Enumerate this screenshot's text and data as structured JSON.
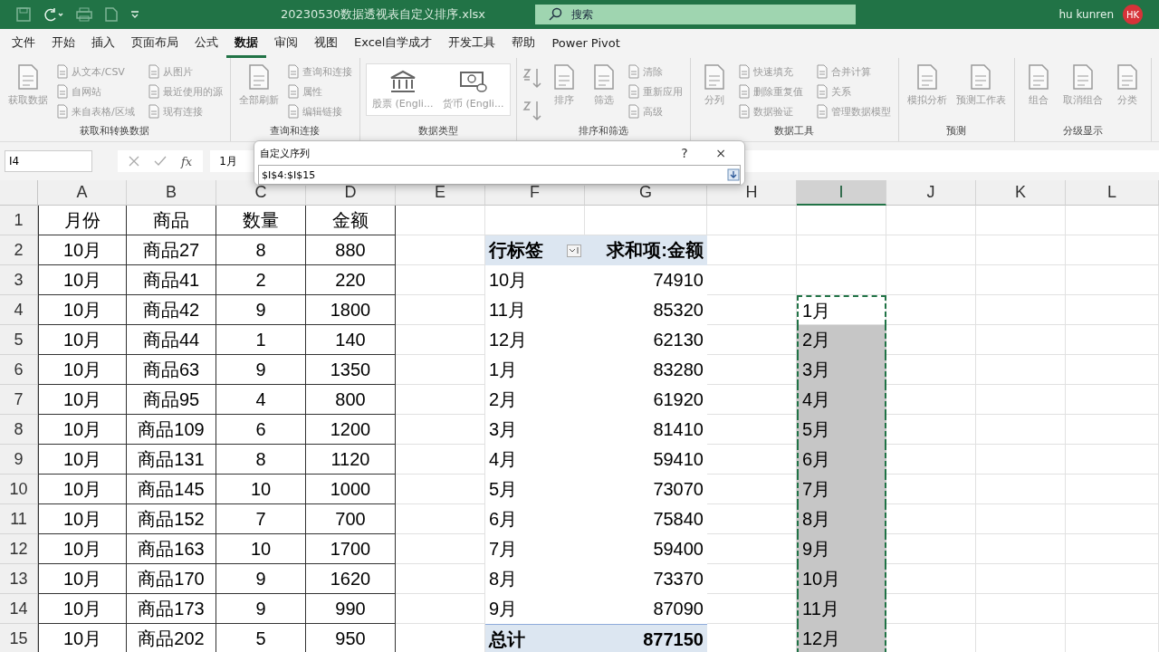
{
  "title_bar": {
    "file_title": "20230530数据透视表自定义排序.xlsx",
    "search_placeholder": "搜索",
    "user_name": "hu kunren",
    "avatar": "HK"
  },
  "menu_tabs": [
    {
      "label": "文件",
      "selected": false
    },
    {
      "label": "开始",
      "selected": false
    },
    {
      "label": "插入",
      "selected": false
    },
    {
      "label": "页面布局",
      "selected": false
    },
    {
      "label": "公式",
      "selected": false
    },
    {
      "label": "数据",
      "selected": true
    },
    {
      "label": "审阅",
      "selected": false
    },
    {
      "label": "视图",
      "selected": false
    },
    {
      "label": "Excel自学成才",
      "selected": false
    },
    {
      "label": "开发工具",
      "selected": false
    },
    {
      "label": "帮助",
      "selected": false
    },
    {
      "label": "Power Pivot",
      "selected": false
    }
  ],
  "ribbon_groups": [
    {
      "label": "获取和转换数据",
      "items": [
        {
          "kind": "large",
          "label": "获取数据"
        },
        {
          "kind": "small",
          "label": "从文本/CSV"
        },
        {
          "kind": "small",
          "label": "自网站"
        },
        {
          "kind": "small",
          "label": "来自表格/区域"
        },
        {
          "kind": "small",
          "label": "从图片"
        },
        {
          "kind": "small",
          "label": "最近使用的源"
        },
        {
          "kind": "small",
          "label": "现有连接"
        }
      ]
    },
    {
      "label": "查询和连接",
      "items": [
        {
          "kind": "large",
          "label": "全部刷新"
        },
        {
          "kind": "small",
          "label": "查询和连接"
        },
        {
          "kind": "small",
          "label": "属性"
        },
        {
          "kind": "small",
          "label": "编辑链接"
        }
      ]
    },
    {
      "label": "数据类型",
      "items": [
        {
          "kind": "gallery",
          "label": "股票 (Engli..."
        },
        {
          "kind": "gallery",
          "label": "货币 (Engli..."
        }
      ]
    },
    {
      "label": "排序和筛选",
      "items": [
        {
          "kind": "icon"
        },
        {
          "kind": "icon"
        },
        {
          "kind": "large",
          "label": "排序"
        },
        {
          "kind": "large",
          "label": "筛选"
        },
        {
          "kind": "small",
          "label": "清除"
        },
        {
          "kind": "small",
          "label": "重新应用"
        },
        {
          "kind": "small",
          "label": "高级"
        }
      ]
    },
    {
      "label": "数据工具",
      "items": [
        {
          "kind": "large",
          "label": "分列"
        },
        {
          "kind": "small",
          "label": "快速填充"
        },
        {
          "kind": "small",
          "label": "删除重复值"
        },
        {
          "kind": "small",
          "label": "数据验证"
        },
        {
          "kind": "small",
          "label": "合并计算"
        },
        {
          "kind": "small",
          "label": "关系"
        },
        {
          "kind": "small",
          "label": "管理数据模型"
        }
      ]
    },
    {
      "label": "预测",
      "items": [
        {
          "kind": "large",
          "label": "模拟分析"
        },
        {
          "kind": "large",
          "label": "预测工作表"
        }
      ]
    },
    {
      "label": "分级显示",
      "items": [
        {
          "kind": "large",
          "label": "组合"
        },
        {
          "kind": "large",
          "label": "取消组合"
        },
        {
          "kind": "large",
          "label": "分类"
        }
      ]
    }
  ],
  "formula_bar": {
    "name_box": "I4",
    "fx": "fx",
    "value": "1月"
  },
  "dialog": {
    "title": "自定义序列",
    "help": "?",
    "close": "×",
    "reference": "$I$4:$I$15"
  },
  "columns": [
    {
      "label": "A",
      "selected": false
    },
    {
      "label": "B",
      "selected": false
    },
    {
      "label": "C",
      "selected": false
    },
    {
      "label": "D",
      "selected": false
    },
    {
      "label": "E",
      "selected": false
    },
    {
      "label": "F",
      "selected": false
    },
    {
      "label": "G",
      "selected": false
    },
    {
      "label": "H",
      "selected": false
    },
    {
      "label": "I",
      "selected": true
    },
    {
      "label": "J",
      "selected": false
    },
    {
      "label": "K",
      "selected": false
    },
    {
      "label": "L",
      "selected": false
    }
  ],
  "rows": [
    {
      "header": "1",
      "table": [
        "月份",
        "商品",
        "数量",
        "金额"
      ]
    },
    {
      "header": "2",
      "table": [
        "10月",
        "商品27",
        "8",
        "880"
      ],
      "pivot": {
        "kind": "header",
        "cells": [
          "行标签",
          "求和项:金额"
        ]
      }
    },
    {
      "header": "3",
      "table": [
        "10月",
        "商品41",
        "2",
        "220"
      ],
      "pivot": {
        "kind": "item",
        "cells": [
          "10月",
          "74910"
        ]
      }
    },
    {
      "header": "4",
      "table": [
        "10月",
        "商品42",
        "9",
        "1800"
      ],
      "pivot": {
        "kind": "item",
        "cells": [
          "11月",
          "85320"
        ]
      },
      "list": {
        "text": "1月",
        "selected": false
      }
    },
    {
      "header": "5",
      "table": [
        "10月",
        "商品44",
        "1",
        "140"
      ],
      "pivot": {
        "kind": "item",
        "cells": [
          "12月",
          "62130"
        ]
      },
      "list": {
        "text": "2月",
        "selected": true
      }
    },
    {
      "header": "6",
      "table": [
        "10月",
        "商品63",
        "9",
        "1350"
      ],
      "pivot": {
        "kind": "item",
        "cells": [
          "1月",
          "83280"
        ]
      },
      "list": {
        "text": "3月",
        "selected": true
      }
    },
    {
      "header": "7",
      "table": [
        "10月",
        "商品95",
        "4",
        "800"
      ],
      "pivot": {
        "kind": "item",
        "cells": [
          "2月",
          "61920"
        ]
      },
      "list": {
        "text": "4月",
        "selected": true
      }
    },
    {
      "header": "8",
      "table": [
        "10月",
        "商品109",
        "6",
        "1200"
      ],
      "pivot": {
        "kind": "item",
        "cells": [
          "3月",
          "81410"
        ]
      },
      "list": {
        "text": "5月",
        "selected": true
      }
    },
    {
      "header": "9",
      "table": [
        "10月",
        "商品131",
        "8",
        "1120"
      ],
      "pivot": {
        "kind": "item",
        "cells": [
          "4月",
          "59410"
        ]
      },
      "list": {
        "text": "6月",
        "selected": true
      }
    },
    {
      "header": "10",
      "table": [
        "10月",
        "商品145",
        "10",
        "1000"
      ],
      "pivot": {
        "kind": "item",
        "cells": [
          "5月",
          "73070"
        ]
      },
      "list": {
        "text": "7月",
        "selected": true
      }
    },
    {
      "header": "11",
      "table": [
        "10月",
        "商品152",
        "7",
        "700"
      ],
      "pivot": {
        "kind": "item",
        "cells": [
          "6月",
          "75840"
        ]
      },
      "list": {
        "text": "8月",
        "selected": true
      }
    },
    {
      "header": "12",
      "table": [
        "10月",
        "商品163",
        "10",
        "1700"
      ],
      "pivot": {
        "kind": "item",
        "cells": [
          "7月",
          "59400"
        ]
      },
      "list": {
        "text": "9月",
        "selected": true
      }
    },
    {
      "header": "13",
      "table": [
        "10月",
        "商品170",
        "9",
        "1620"
      ],
      "pivot": {
        "kind": "item",
        "cells": [
          "8月",
          "73370"
        ]
      },
      "list": {
        "text": "10月",
        "selected": true
      }
    },
    {
      "header": "14",
      "table": [
        "10月",
        "商品173",
        "9",
        "990"
      ],
      "pivot": {
        "kind": "item",
        "cells": [
          "9月",
          "87090"
        ]
      },
      "list": {
        "text": "11月",
        "selected": true
      }
    },
    {
      "header": "15",
      "table": [
        "10月",
        "商品202",
        "5",
        "950"
      ],
      "pivot": {
        "kind": "total",
        "cells": [
          "总计",
          "877150"
        ]
      },
      "list": {
        "text": "12月",
        "selected": true
      }
    }
  ]
}
